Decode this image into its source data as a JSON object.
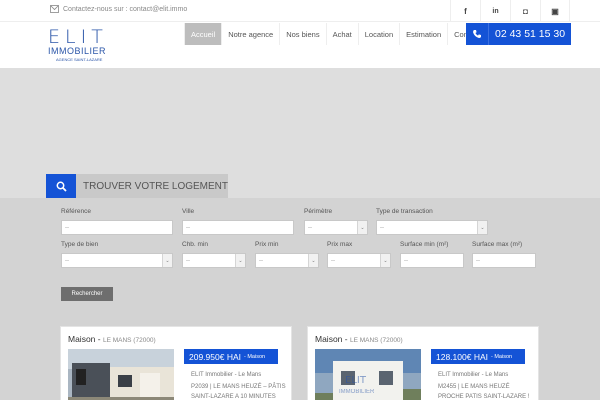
{
  "topbar": {
    "contact_text": "Contactez-nous sur : contact@elit.immo",
    "social": [
      {
        "name": "facebook",
        "glyph": "f"
      },
      {
        "name": "linkedin",
        "glyph": "in"
      },
      {
        "name": "instagram",
        "glyph": "◘"
      },
      {
        "name": "youtube",
        "glyph": "▣"
      }
    ]
  },
  "logo": {
    "big": "ELIT",
    "line1": "IMMOBILIER",
    "line2": "AGENCE SAINT-LAZARE"
  },
  "nav": [
    "Accueil",
    "Notre agence",
    "Nos biens",
    "Achat",
    "Location",
    "Estimation",
    "Contact"
  ],
  "nav_active": "Accueil",
  "phone": "02 43 51 15 30",
  "search": {
    "tab_label": "TROUVER VOTRE LOGEMENT",
    "reference_label": "Référence",
    "reference_placeholder": "--",
    "ville_label": "Ville",
    "ville_placeholder": "--",
    "perimetre_label": "Périmètre",
    "perimetre_value": "--",
    "type_transaction_label": "Type de transaction",
    "type_transaction_value": "--",
    "type_bien_label": "Type de bien",
    "type_bien_value": "--",
    "chb_min_label": "Chb. min",
    "chb_min_value": "--",
    "prix_min_label": "Prix min",
    "prix_min_value": "--",
    "prix_max_label": "Prix max",
    "prix_max_value": "--",
    "surface_min_label": "Surface min (m²)",
    "surface_min_placeholder": "--",
    "surface_max_label": "Surface max (m²)",
    "surface_max_placeholder": "--",
    "button_label": "Rechercher"
  },
  "listings": [
    {
      "type": "Maison",
      "separator": " - ",
      "city": "LE MANS (72000)",
      "price": "209.950€ HAI",
      "price_sub": "- Maison",
      "agency": "ELIT Immobilier - Le Mans",
      "desc": "P2039 | LE MANS HEUZÉ – PÂTIS SAINT-LAZARE A 10 MINUTES"
    },
    {
      "type": "Maison",
      "separator": " - ",
      "city": "LE MANS (72000)",
      "price": "128.100€ HAI",
      "price_sub": "- Maison",
      "agency": "ELIT Immobilier - Le Mans",
      "desc": "M2455 | LE MANS HEUZÉ PROCHE PATIS SAINT-LAZARE !"
    }
  ],
  "colors": {
    "accent": "#1453d6",
    "hero": "#dedede",
    "panel": "#d3d3d3"
  }
}
